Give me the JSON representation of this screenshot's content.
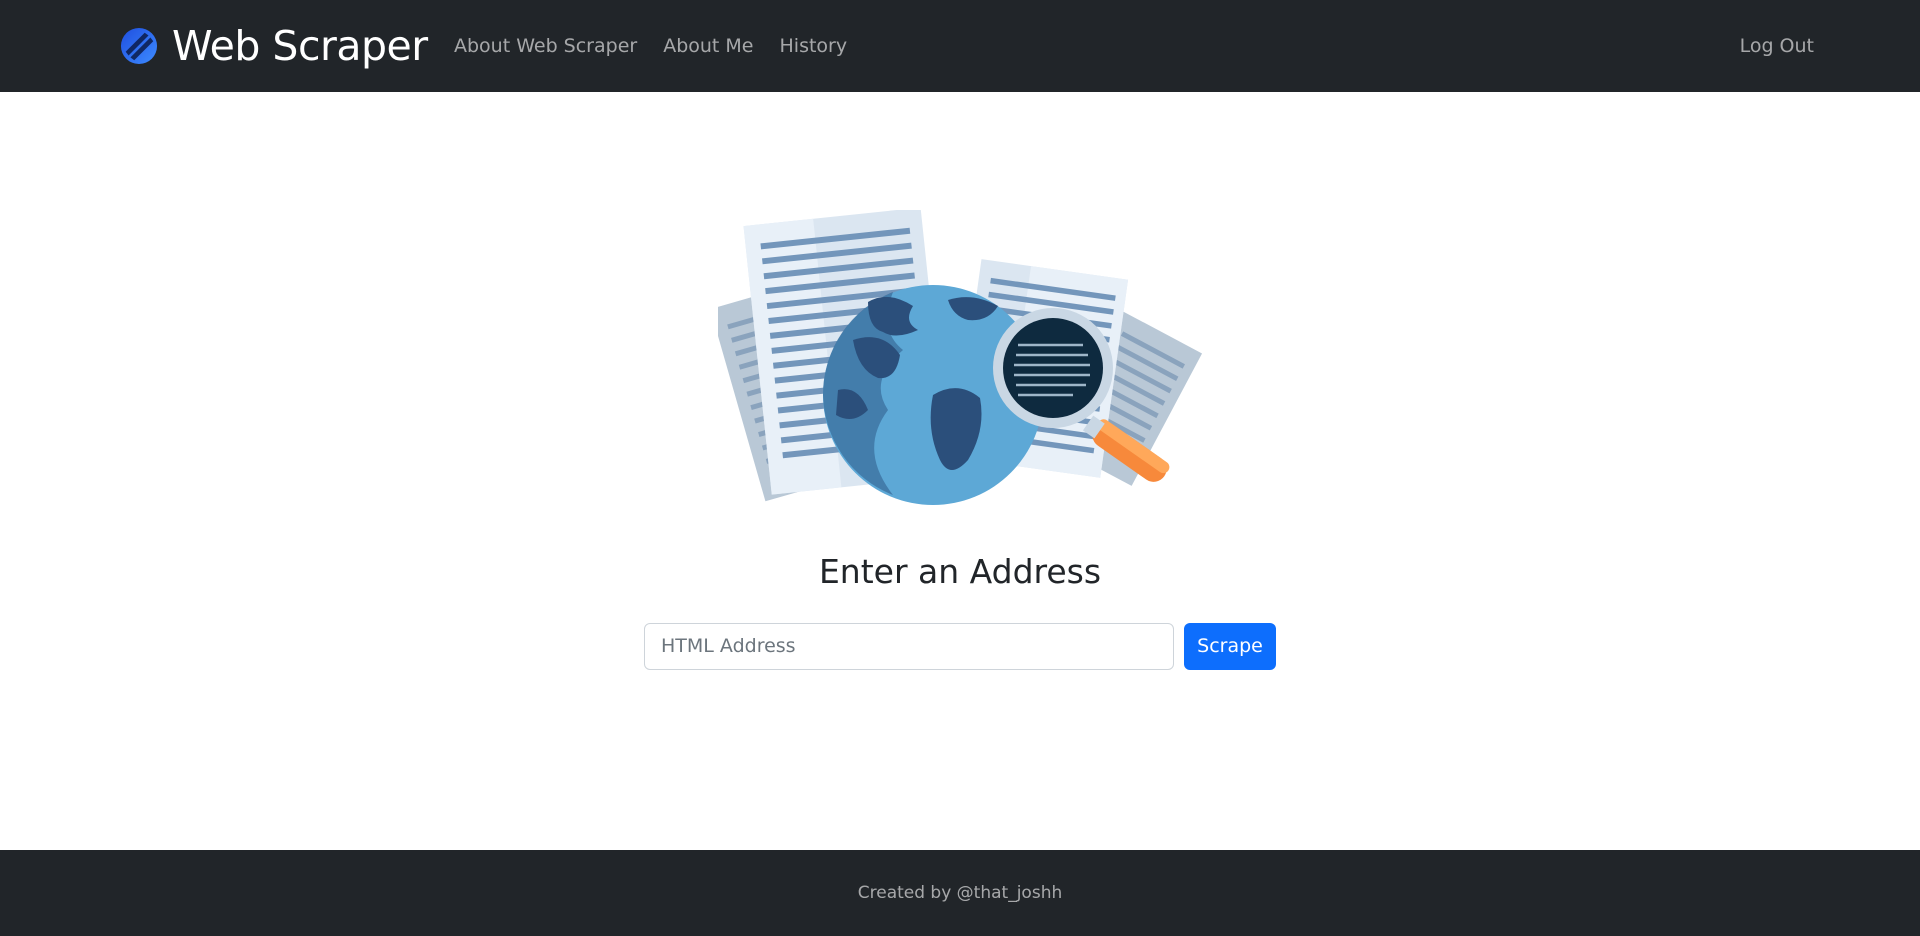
{
  "navbar": {
    "brand": "Web Scraper",
    "brand_icon": "web-scraper-logo-icon",
    "links": [
      {
        "label": "About Web Scraper"
      },
      {
        "label": "About Me"
      },
      {
        "label": "History"
      }
    ],
    "logout_label": "Log Out"
  },
  "main": {
    "illustration_icon": "globe-documents-magnifier-illustration",
    "heading": "Enter an Address",
    "input_placeholder": "HTML Address",
    "input_value": "",
    "button_label": "Scrape"
  },
  "footer": {
    "text": "Created by @that_joshh"
  },
  "colors": {
    "navbar_bg": "#212529",
    "primary": "#0d6efd",
    "nav_text": "rgba(255,255,255,0.6)",
    "accent_orange": "#f7893b"
  }
}
